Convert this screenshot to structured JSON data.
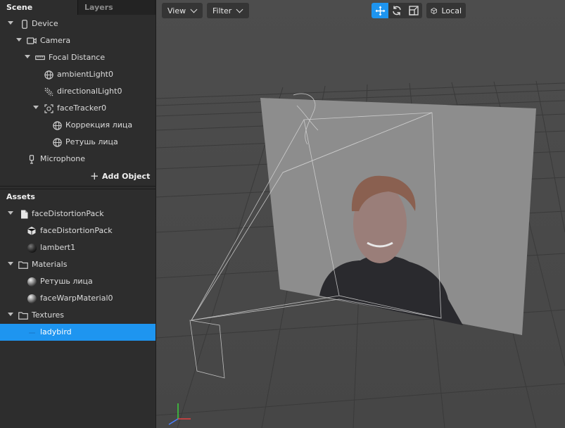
{
  "tabs": {
    "scene": "Scene",
    "layers": "Layers"
  },
  "scene_tree": [
    {
      "label": "Device",
      "icon": "phone-icon"
    },
    {
      "label": "Camera",
      "icon": "camera-icon"
    },
    {
      "label": "Focal Distance",
      "icon": "ruler-icon"
    },
    {
      "label": "ambientLight0",
      "icon": "globe-icon"
    },
    {
      "label": "directionalLight0",
      "icon": "directional-light-icon"
    },
    {
      "label": "faceTracker0",
      "icon": "face-tracker-icon"
    },
    {
      "label": "Коррекция лица",
      "icon": "globe-icon"
    },
    {
      "label": "Ретушь лица",
      "icon": "globe-icon"
    },
    {
      "label": "Microphone",
      "icon": "microphone-icon"
    }
  ],
  "add_object": "Add Object",
  "assets_header": "Assets",
  "assets_tree": [
    {
      "label": "faceDistortionPack",
      "icon": "file-icon"
    },
    {
      "label": "faceDistortionPack",
      "icon": "cube-icon"
    },
    {
      "label": "lambert1",
      "icon": "material-sphere-icon"
    },
    {
      "label": "Materials",
      "icon": "folder-icon"
    },
    {
      "label": "Ретушь лица",
      "icon": "material-sphere-icon"
    },
    {
      "label": "faceWarpMaterial0",
      "icon": "material-sphere-icon"
    },
    {
      "label": "Textures",
      "icon": "folder-icon"
    },
    {
      "label": "ladybird",
      "icon": "texture-icon"
    }
  ],
  "toolbar": {
    "view": "View",
    "filter": "Filter",
    "local": "Local",
    "transform_tools": [
      "move-icon",
      "rotate-icon",
      "scale-icon"
    ],
    "active_tool": "move-icon"
  },
  "colors": {
    "selection": "#1e95f0",
    "panel": "#2d2d2d",
    "viewport": "#4a4a4a"
  }
}
